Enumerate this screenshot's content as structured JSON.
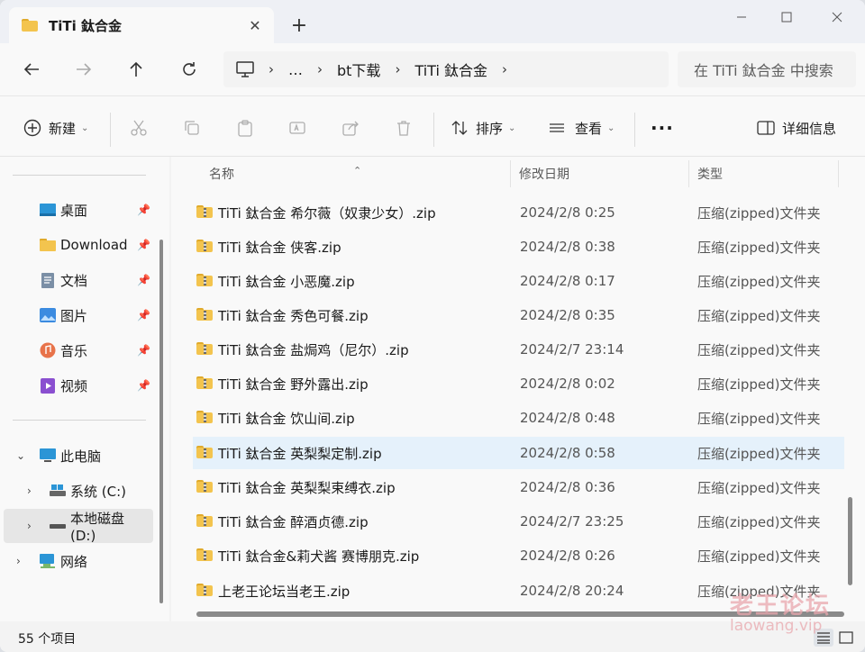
{
  "tab": {
    "title": "TiTi 鈦合金"
  },
  "address": {
    "crumbs": [
      "…",
      "bt下载",
      "TiTi 鈦合金"
    ]
  },
  "search": {
    "placeholder": "在 TiTi 鈦合金 中搜索"
  },
  "commands": {
    "new": "新建",
    "sort": "排序",
    "view": "查看",
    "details": "详细信息"
  },
  "sidebar": {
    "quick_access": [
      {
        "label": "桌面",
        "icon": "desktop-icon"
      },
      {
        "label": "Download",
        "icon": "folder-icon"
      },
      {
        "label": "文档",
        "icon": "documents-icon"
      },
      {
        "label": "图片",
        "icon": "pictures-icon"
      },
      {
        "label": "音乐",
        "icon": "music-icon"
      },
      {
        "label": "视频",
        "icon": "videos-icon"
      }
    ],
    "this_pc": "此电脑",
    "drives": [
      "系统 (C:)",
      "本地磁盘 (D:)"
    ],
    "network": "网络"
  },
  "columns": {
    "name": "名称",
    "modified": "修改日期",
    "type": "类型"
  },
  "files": [
    {
      "name": "TiTi 鈦合金 希尔薇（奴隶少女）.zip",
      "date": "2024/2/8 0:25",
      "type": "压缩(zipped)文件夹"
    },
    {
      "name": "TiTi 鈦合金 侠客.zip",
      "date": "2024/2/8 0:38",
      "type": "压缩(zipped)文件夹"
    },
    {
      "name": "TiTi 鈦合金 小恶魔.zip",
      "date": "2024/2/8 0:17",
      "type": "压缩(zipped)文件夹"
    },
    {
      "name": "TiTi 鈦合金 秀色可餐.zip",
      "date": "2024/2/8 0:35",
      "type": "压缩(zipped)文件夹"
    },
    {
      "name": "TiTi 鈦合金 盐焗鸡（尼尔）.zip",
      "date": "2024/2/7 23:14",
      "type": "压缩(zipped)文件夹"
    },
    {
      "name": "TiTi 鈦合金 野外露出.zip",
      "date": "2024/2/8 0:02",
      "type": "压缩(zipped)文件夹"
    },
    {
      "name": "TiTi 鈦合金 饮山间.zip",
      "date": "2024/2/8 0:48",
      "type": "压缩(zipped)文件夹"
    },
    {
      "name": "TiTi 鈦合金 英梨梨定制.zip",
      "date": "2024/2/8 0:58",
      "type": "压缩(zipped)文件夹"
    },
    {
      "name": "TiTi 鈦合金 英梨梨束缚衣.zip",
      "date": "2024/2/8 0:36",
      "type": "压缩(zipped)文件夹"
    },
    {
      "name": "TiTi 鈦合金 醉酒贞德.zip",
      "date": "2024/2/7 23:25",
      "type": "压缩(zipped)文件夹"
    },
    {
      "name": "TiTi 鈦合金&莉犬酱 赛博朋克.zip",
      "date": "2024/2/8 0:26",
      "type": "压缩(zipped)文件夹"
    },
    {
      "name": "上老王论坛当老王.zip",
      "date": "2024/2/8 20:24",
      "type": "压缩(zipped)文件夹"
    }
  ],
  "status": {
    "count": "55 个项目"
  },
  "watermark": {
    "line1": "老王论坛",
    "line2": "laowang.vip"
  }
}
